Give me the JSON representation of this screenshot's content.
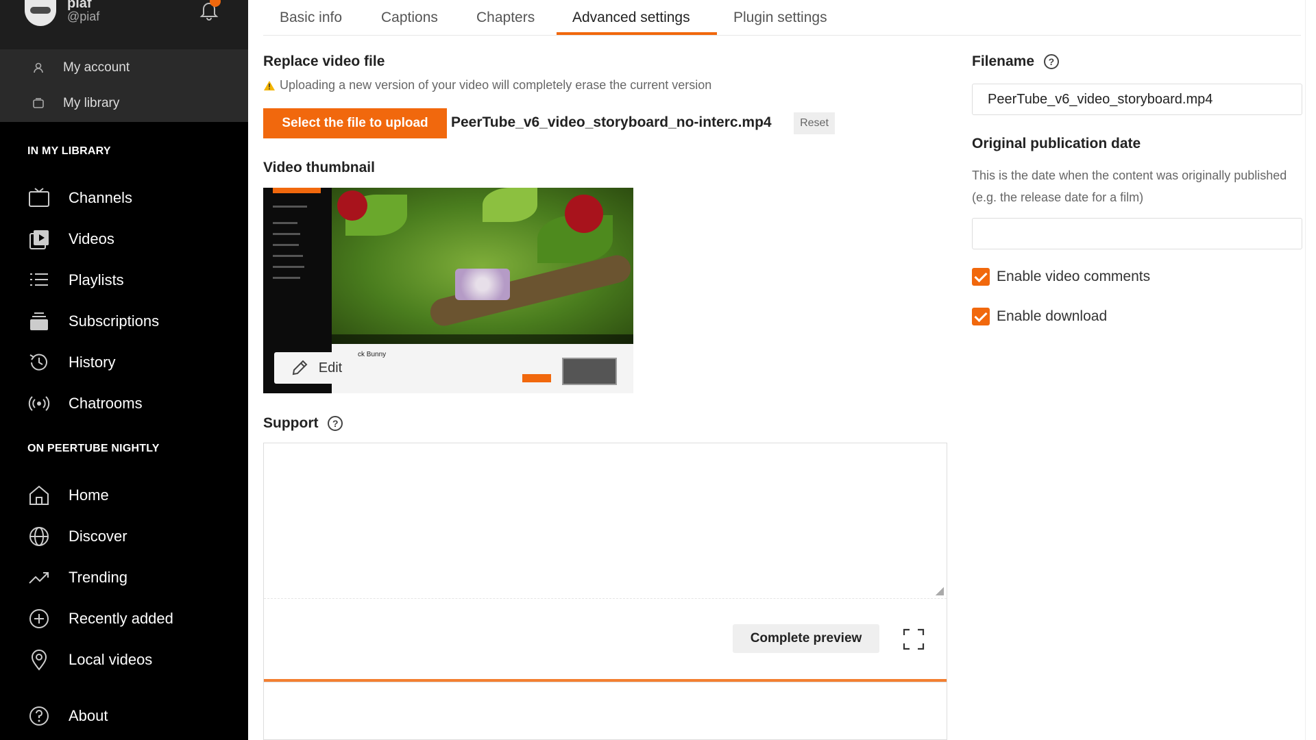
{
  "user": {
    "name": "piaf",
    "handle": "@piaf"
  },
  "account_menu": [
    {
      "label": "My account",
      "icon": "user-icon"
    },
    {
      "label": "My library",
      "icon": "library-icon"
    }
  ],
  "sidebar": {
    "section_library": "IN MY LIBRARY",
    "library_items": [
      {
        "label": "Channels",
        "icon": "channels-icon"
      },
      {
        "label": "Videos",
        "icon": "videos-icon"
      },
      {
        "label": "Playlists",
        "icon": "playlists-icon"
      },
      {
        "label": "Subscriptions",
        "icon": "subscriptions-icon"
      },
      {
        "label": "History",
        "icon": "history-icon"
      },
      {
        "label": "Chatrooms",
        "icon": "chatrooms-icon"
      }
    ],
    "section_instance": "ON PEERTUBE NIGHTLY",
    "instance_items": [
      {
        "label": "Home",
        "icon": "home-icon"
      },
      {
        "label": "Discover",
        "icon": "globe-icon"
      },
      {
        "label": "Trending",
        "icon": "trending-icon"
      },
      {
        "label": "Recently added",
        "icon": "plus-circle-icon"
      },
      {
        "label": "Local videos",
        "icon": "location-icon"
      }
    ],
    "about": {
      "label": "About",
      "icon": "help-circle-icon"
    }
  },
  "tabs": [
    {
      "label": "Basic info",
      "active": false
    },
    {
      "label": "Captions",
      "active": false
    },
    {
      "label": "Chapters",
      "active": false
    },
    {
      "label": "Advanced settings",
      "active": true
    },
    {
      "label": "Plugin settings",
      "active": false
    }
  ],
  "replace_file": {
    "title": "Replace video file",
    "warning": "Uploading a new version of your video will completely erase the current version",
    "upload_button": "Select the file to upload",
    "selected_file": "PeerTube_v6_video_storyboard_no-interc.mp4",
    "reset_button": "Reset"
  },
  "thumbnail": {
    "title": "Video thumbnail",
    "edit_button": "Edit",
    "inner_title": "ck Bunny"
  },
  "support": {
    "title": "Support",
    "preview_button": "Complete preview"
  },
  "filename": {
    "title": "Filename",
    "value": "PeerTube_v6_video_storyboard.mp4"
  },
  "publication_date": {
    "title": "Original publication date",
    "help": "This is the date when the content was originally published (e.g. the release date for a film)",
    "value": ""
  },
  "options": [
    {
      "label": "Enable video comments",
      "checked": true
    },
    {
      "label": "Enable download",
      "checked": true
    }
  ],
  "colors": {
    "accent": "#f1680d",
    "sidebar_bg": "#000000"
  }
}
